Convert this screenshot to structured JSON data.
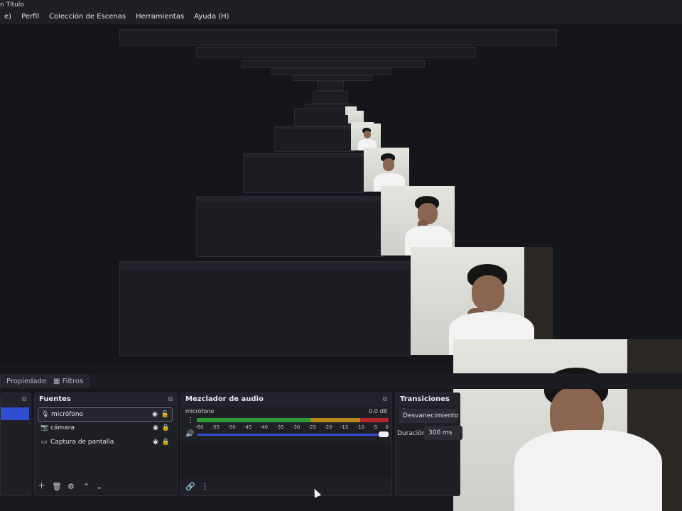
{
  "window": {
    "title": "n Título"
  },
  "menu": [
    "e)",
    "Perfil",
    "Colección de Escenas",
    "Herramientas",
    "Ayuda (H)"
  ],
  "tabs": {
    "properties": "Propiedades",
    "filters": "Filtros"
  },
  "sources": {
    "header": "Fuentes",
    "items": [
      {
        "label": "micrófono",
        "icon": "microphone-icon"
      },
      {
        "label": "cámara",
        "icon": "camera-icon"
      },
      {
        "label": "Captura de pantalla",
        "icon": "monitor-icon"
      }
    ]
  },
  "mixer": {
    "header": "Mezclador de audio",
    "channel": "micrófono",
    "level": "0.0 dB",
    "ticks": [
      "-60",
      "-55",
      "-50",
      "-45",
      "-40",
      "-35",
      "-30",
      "-25",
      "-20",
      "-15",
      "-10",
      "-5",
      "0"
    ]
  },
  "transitions": {
    "header": "Transiciones de u",
    "type": "Desvanecimiento",
    "duration_label": "Duración",
    "duration_value": "300 ms"
  },
  "colors": {
    "accent": "#2f4fd0",
    "meter_green": "#2e9a35",
    "meter_yellow": "#b58a1b",
    "meter_red": "#b3262b"
  }
}
